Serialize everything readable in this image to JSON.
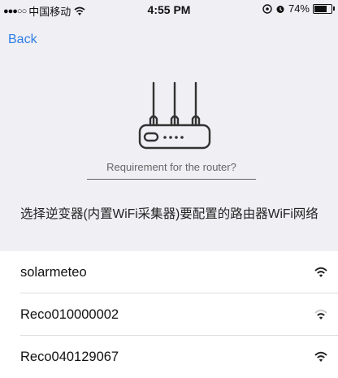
{
  "status_bar": {
    "signal": "●●●○○",
    "carrier": "中国移动",
    "time": "4:55 PM",
    "battery_percent": "74%",
    "battery_level": 0.74,
    "icons": [
      "wifi-icon",
      "location-icon",
      "alarm-icon",
      "battery-icon"
    ]
  },
  "nav": {
    "back_label": "Back"
  },
  "router": {
    "icon": "router-icon",
    "requirement_link": "Requirement for the router?"
  },
  "instruction": "选择逆变器(内置WiFi采集器)要配置的路由器WiFi网络",
  "networks": [
    {
      "name": "solarmeteo",
      "signal": "strong"
    },
    {
      "name": "Reco010000002",
      "signal": "medium"
    },
    {
      "name": "Reco040129067",
      "signal": "strong"
    }
  ],
  "colors": {
    "link": "#2f7ee6",
    "background": "#efeff4",
    "list_background": "#ffffff"
  }
}
